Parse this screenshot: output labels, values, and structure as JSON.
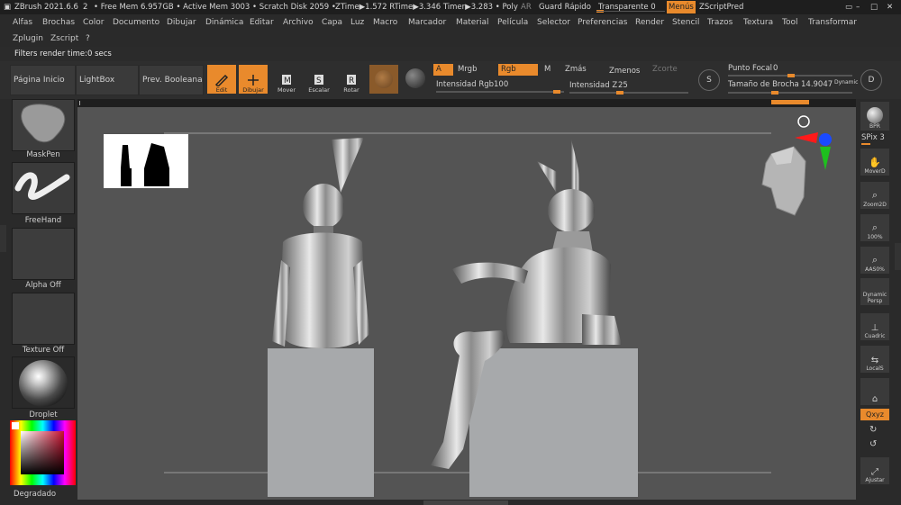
{
  "titlebar": {
    "app": "ZBrush 2021.6.6",
    "num": "2",
    "stats": "• Free Mem 6.957GB • Active Mem 3003 • Scratch Disk 2059 •",
    "timers": "ZTime▶1.572 RTime▶3.346 Timer▶3.283 • Poly",
    "ar": "AR",
    "quicksave": "Guard Rápido",
    "transparent": "Transparente 0",
    "menus": "Menús",
    "zscript": "ZScriptPred"
  },
  "menus": [
    "Alfas",
    "Brochas",
    "Color",
    "Documento",
    "Dibujar",
    "Dinámica",
    "Editar",
    "Archivo",
    "Capa",
    "Luz",
    "Macro",
    "Marcador",
    "Material",
    "Película",
    "Selector",
    "Preferencias",
    "Render",
    "Stencil",
    "Trazos",
    "Textura",
    "Tool",
    "Transformar",
    "Zplugin",
    "Zscript",
    "?"
  ],
  "status": "Filters render time:0 secs",
  "toolbar": {
    "home": "Página Inicio",
    "lightbox": "LightBox",
    "boolean": "Prev. Booleana",
    "edit": "Edit",
    "draw": "Dibujar",
    "move": "Mover",
    "scale": "Escalar",
    "rotate": "Rotar",
    "a": "A",
    "mrgb": "Mrgb",
    "rgb": "Rgb",
    "m": "M",
    "zadd": "Zmás",
    "zsub": "Zmenos",
    "zcut": "Zcorte",
    "rgb_intensity_label": "Intensidad Rgb",
    "rgb_intensity": "100",
    "z_intensity_label": "Intensidad Z",
    "z_intensity": "25",
    "focal_label": "Punto Focal",
    "focal": "0",
    "brush_size_label": "Tamaño de Brocha",
    "brush_size": "14.9047",
    "dynamic": "Dynamic",
    "s_icon": "S",
    "d_icon": "D"
  },
  "left_tiles": {
    "maskpen": "MaskPen",
    "freehand": "FreeHand",
    "alpha": "Alpha Off",
    "texture": "Texture Off",
    "material": "Droplet",
    "gradient": "Degradado"
  },
  "right_panel": {
    "bpr": "BPR",
    "spix": "SPix 3",
    "move": "MoverD",
    "zoom2d": "Zoom2D",
    "zoom100": "100%",
    "aahalf": "AAS0%",
    "dynamic": "Dynamic",
    "persp": "Persp",
    "floor": "Cuadric",
    "local": "LocalS",
    "xyz": "Qxyz",
    "fit": "Ajustar"
  },
  "colors": {
    "accent": "#e98a2c",
    "canvas": "#545454",
    "panel": "#2a2a2a"
  }
}
